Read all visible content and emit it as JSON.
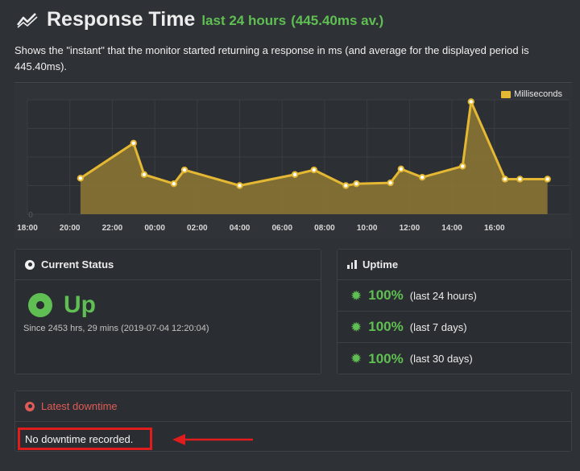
{
  "header": {
    "title": "Response Time",
    "period": "last 24 hours",
    "average": "(445.40ms av.)"
  },
  "description": "Shows the \"instant\" that the monitor started returning a response in ms (and average for the displayed period is 445.40ms).",
  "chart_data": {
    "type": "area",
    "legend": "Milliseconds",
    "legend_position": "top-right",
    "color": "#e4b833",
    "y_tick_labels": [
      "0"
    ],
    "x_tick_labels": [
      "18:00",
      "20:00",
      "22:00",
      "00:00",
      "02:00",
      "04:00",
      "06:00",
      "08:00",
      "10:00",
      "12:00",
      "14:00",
      "16:00"
    ],
    "xlim": [
      18,
      43.5
    ],
    "ylim": [
      0,
      620
    ],
    "series": [
      {
        "name": "Milliseconds",
        "x": [
          20.5,
          23.0,
          23.5,
          24.9,
          25.4,
          28.0,
          30.6,
          31.5,
          33.0,
          33.5,
          35.1,
          35.6,
          36.6,
          38.5,
          38.9,
          40.5,
          41.2,
          42.5
        ],
        "y": [
          195,
          385,
          215,
          165,
          240,
          155,
          215,
          240,
          155,
          165,
          170,
          245,
          200,
          260,
          610,
          190,
          190,
          190
        ]
      }
    ]
  },
  "status": {
    "heading": "Current Status",
    "state": "Up",
    "since": "Since 2453 hrs, 29 mins (2019-07-04 12:20:04)"
  },
  "uptime": {
    "heading": "Uptime",
    "rows": [
      {
        "value": "100%",
        "period": "(last 24 hours)"
      },
      {
        "value": "100%",
        "period": "(last 7 days)"
      },
      {
        "value": "100%",
        "period": "(last 30 days)"
      }
    ]
  },
  "downtime": {
    "heading": "Latest downtime",
    "message": "No downtime recorded."
  },
  "colors": {
    "accent_green": "#5fbf52",
    "accent_red": "#e05b57",
    "highlight_box": "#e01c1c",
    "chart_fill": "#e4b833"
  }
}
